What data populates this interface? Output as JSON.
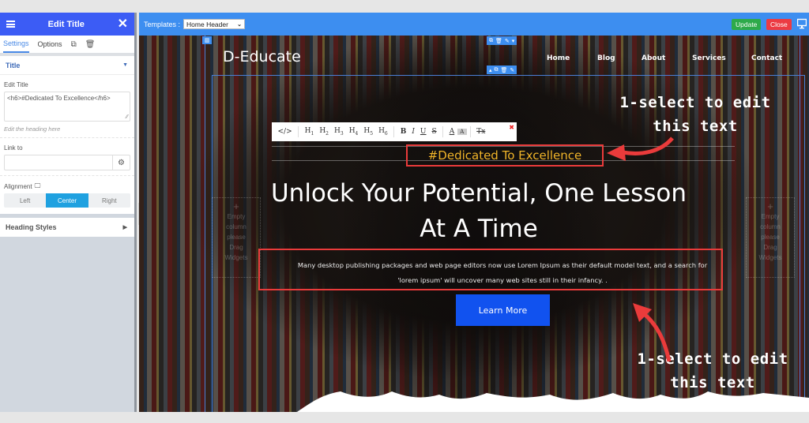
{
  "panel": {
    "title": "Edit Title",
    "tabs": [
      {
        "label": "Settings",
        "active": true
      },
      {
        "label": "Options",
        "active": false
      }
    ],
    "section_title": "Title",
    "edit_title_label": "Edit Title",
    "edit_title_value": "<h6>#Dedicated To Excellence</h6>",
    "edit_title_hint": "Edit the heading here",
    "link_label": "Link to",
    "link_value": "",
    "alignment_label": "Alignment",
    "alignment_options": [
      "Left",
      "Center",
      "Right"
    ],
    "alignment_selected": "Center",
    "heading_styles_label": "Heading Styles"
  },
  "topbar": {
    "templates_label": "Templates :",
    "template_selected": "Home Header",
    "update_label": "Update",
    "close_label": "Close"
  },
  "site": {
    "logo": "D-Educate",
    "nav": [
      "Home",
      "Blog",
      "About",
      "Services",
      "Contact"
    ],
    "empty_column_text": [
      "Empty",
      "column",
      "please",
      "Drag",
      "Widgets"
    ],
    "tagline": "#Dedicated To Excellence",
    "hero_title_line1": "Unlock Your Potential, One Lesson",
    "hero_title_line2": "At A Time",
    "hero_text_line1": "Many desktop publishing packages and web page editors now use Lorem Ipsum as their default model text, and a search for",
    "hero_text_line2": "'lorem ipsum' will uncover many web sites still in their infancy. .",
    "cta_label": "Learn More"
  },
  "toolbar": {
    "items": [
      "</>",
      "H1",
      "H2",
      "H3",
      "H4",
      "H5",
      "H6",
      "B",
      "I",
      "U",
      "S",
      "A",
      "A",
      "Tx"
    ]
  },
  "annotations": {
    "top_line1": "1-select to edit",
    "top_line2": "this text",
    "bottom_line1": "1-select to edit",
    "bottom_line2": "this text"
  },
  "colors": {
    "panel_header": "#3c5cf5",
    "topbar": "#3d8ef0",
    "update": "#2eaa4a",
    "close": "#ec3b43",
    "tagline": "#f0b429",
    "highlight": "#ea3b3b",
    "cta": "#1152ef"
  }
}
